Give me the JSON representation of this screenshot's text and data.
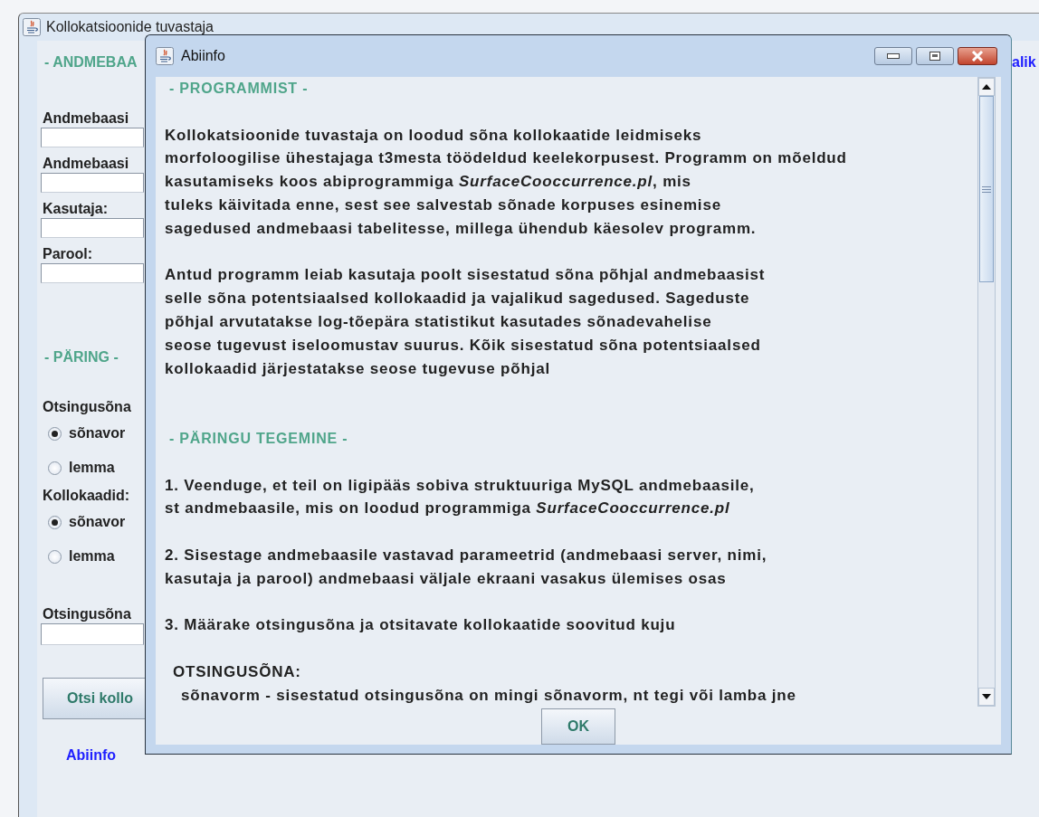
{
  "main_window": {
    "title": "Kollokatsioonide tuvastaja",
    "database_section": {
      "heading": "- ANDMEBAA",
      "fields": [
        {
          "label": "Andmebaasi"
        },
        {
          "label": "Andmebaasi"
        },
        {
          "label": "Kasutaja:"
        },
        {
          "label": "Parool:"
        }
      ]
    },
    "query_section": {
      "heading": "- PÄRING -",
      "groups": [
        {
          "label": "Otsingusõna",
          "options": [
            {
              "label": "sõnavor",
              "selected": true
            },
            {
              "label": "lemma",
              "selected": false
            }
          ]
        },
        {
          "label": "Kollokaadid:",
          "options": [
            {
              "label": "sõnavor",
              "selected": true
            },
            {
              "label": "lemma",
              "selected": false
            }
          ]
        }
      ],
      "search_field": {
        "label": "Otsingusõna"
      },
      "search_button": "Otsi kollo",
      "help_link": "Abiinfo"
    },
    "right_link": "alik"
  },
  "dialog": {
    "title": "Abiinfo",
    "blocks": [
      {
        "kind": "heading",
        "text": "- PROGRAMMIST -"
      },
      {
        "kind": "gap"
      },
      {
        "kind": "paragraph",
        "lines": [
          "Kollokatsioonide tuvastaja on loodud sõna kollokaatide leidmiseks",
          "morfoloogilise ühestajaga t3mesta töödeldud keelekorpusest. Programm on mõeldud",
          "kasutamiseks koos abiprogrammiga *SurfaceCooccurrence.pl*, mis",
          "tuleks käivitada enne, sest see salvestab sõnade korpuses esinemise",
          "sagedused andmebaasi tabelitesse, millega ühendub käesolev programm."
        ]
      },
      {
        "kind": "gap"
      },
      {
        "kind": "paragraph",
        "lines": [
          "Antud programm leiab kasutaja poolt sisestatud sõna põhjal andmebaasist",
          "selle sõna potentsiaalsed kollokaadid ja vajalikud sagedused. Sageduste",
          "põhjal arvutatakse log-tõepära statistikut kasutades sõnadevahelise",
          "seose tugevust iseloomustav suurus. Kõik sisestatud sõna potentsiaalsed",
          "kollokaadid järjestatakse seose tugevuse põhjal"
        ]
      },
      {
        "kind": "gap"
      },
      {
        "kind": "gap"
      },
      {
        "kind": "heading",
        "text": "- PÄRINGU TEGEMINE -"
      },
      {
        "kind": "gap"
      },
      {
        "kind": "paragraph",
        "lines": [
          "1. Veenduge, et teil on ligipääs sobiva struktuuriga MySQL andmebaasile,",
          "st andmebaasile, mis on loodud programmiga *SurfaceCooccurrence.pl*"
        ]
      },
      {
        "kind": "gap"
      },
      {
        "kind": "paragraph",
        "lines": [
          "2. Sisestage andmebaasile vastavad parameetrid (andmebaasi server, nimi,",
          "kasutaja ja parool) andmebaasi väljale ekraani vasakus ülemises osas"
        ]
      },
      {
        "kind": "gap"
      },
      {
        "kind": "paragraph",
        "lines": [
          "3. Määrake otsingusõna ja otsitavate kollokaatide soovitud kuju"
        ]
      },
      {
        "kind": "gap"
      },
      {
        "kind": "subheading",
        "text": "OTSINGUSÕNA:"
      },
      {
        "kind": "indented",
        "text": "sõnavorm - sisestatud otsingusõna on mingi sõnavorm, nt tegi või lamba jne"
      }
    ],
    "ok_button": "OK"
  }
}
